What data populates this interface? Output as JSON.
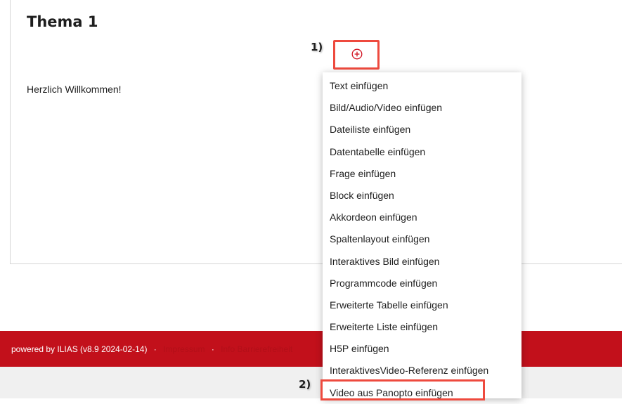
{
  "page": {
    "title": "Thema 1",
    "welcome_text": "Herzlich Willkommen!"
  },
  "add_button": {
    "icon": "plus-circle-icon",
    "color": "#d11220"
  },
  "callouts": {
    "first": "1)",
    "second": "2)"
  },
  "menu": {
    "items": [
      {
        "label": "Text einfügen"
      },
      {
        "label": "Bild/Audio/Video einfügen"
      },
      {
        "label": "Dateiliste einfügen"
      },
      {
        "label": "Datentabelle einfügen"
      },
      {
        "label": "Frage einfügen"
      },
      {
        "label": "Block einfügen"
      },
      {
        "label": "Akkordeon einfügen"
      },
      {
        "label": "Spaltenlayout einfügen"
      },
      {
        "label": "Interaktives Bild einfügen"
      },
      {
        "label": "Programmcode einfügen"
      },
      {
        "label": "Erweiterte Tabelle einfügen"
      },
      {
        "label": "Erweiterte Liste einfügen"
      },
      {
        "label": "H5P einfügen"
      },
      {
        "label": "InteraktivesVideo-Referenz einfügen"
      },
      {
        "label": "Video aus Panopto einfügen"
      }
    ]
  },
  "footer": {
    "powered_by": "powered by ILIAS (v8.9 2024-02-14)",
    "separator": "·",
    "link_impressum": "Impressum",
    "link_barrierefreiheit": "Info Barrierefreiheit"
  },
  "colors": {
    "footer_bg": "#c2101b",
    "highlight": "#ee4a3e"
  }
}
